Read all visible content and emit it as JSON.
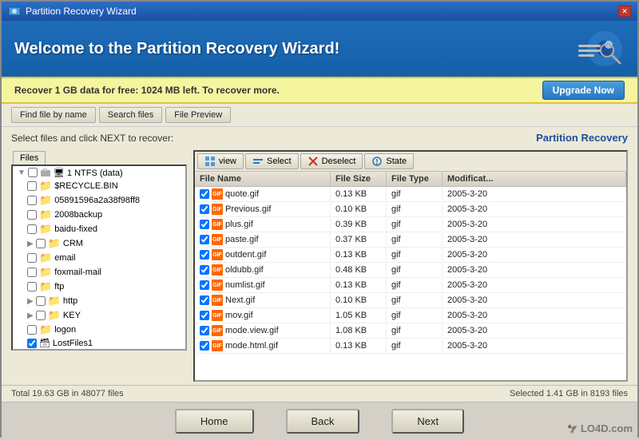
{
  "titlebar": {
    "title": "Partition Recovery Wizard",
    "close": "✕"
  },
  "header": {
    "title": "Welcome to the Partition Recovery Wizard!"
  },
  "promo": {
    "text": "Recover 1 GB data for free: 1024 MB left. To recover more.",
    "upgrade_label": "Upgrade Now"
  },
  "toolbar": {
    "find_label": "Find file by name",
    "search_label": "Search files",
    "preview_label": "File Preview"
  },
  "content": {
    "select_instruction": "Select files and click NEXT to recover:",
    "partition_label": "Partition Recovery",
    "files_tab": "Files"
  },
  "file_tree": {
    "root": "1 NTFS (data)",
    "items": [
      {
        "name": "$RECYCLE.BIN",
        "indent": 2,
        "checked": false
      },
      {
        "name": "05891596a2a38f98ff8",
        "indent": 2,
        "checked": false
      },
      {
        "name": "2008backup",
        "indent": 2,
        "checked": false
      },
      {
        "name": "baidu-fixed",
        "indent": 2,
        "checked": false
      },
      {
        "name": "CRM",
        "indent": 2,
        "checked": false
      },
      {
        "name": "email",
        "indent": 2,
        "checked": false
      },
      {
        "name": "foxmail-mail",
        "indent": 2,
        "checked": false
      },
      {
        "name": "ftp",
        "indent": 2,
        "checked": false
      },
      {
        "name": "http",
        "indent": 2,
        "checked": false
      },
      {
        "name": "KEY",
        "indent": 2,
        "checked": false
      },
      {
        "name": "logon",
        "indent": 2,
        "checked": false
      },
      {
        "name": "LostFiles1",
        "indent": 2,
        "checked": true
      }
    ]
  },
  "file_toolbar": {
    "view_label": "view",
    "select_label": "Select",
    "deselect_label": "Deselect",
    "state_label": "State"
  },
  "file_table": {
    "headers": [
      "File Name",
      "File Size",
      "File Type",
      "Modificat..."
    ],
    "rows": [
      {
        "name": "quote.gif",
        "size": "0.13 KB",
        "type": "gif",
        "modified": "2005-3-20",
        "checked": true
      },
      {
        "name": "Previous.gif",
        "size": "0.10 KB",
        "type": "gif",
        "modified": "2005-3-20",
        "checked": true
      },
      {
        "name": "plus.gif",
        "size": "0.39 KB",
        "type": "gif",
        "modified": "2005-3-20",
        "checked": true
      },
      {
        "name": "paste.gif",
        "size": "0.37 KB",
        "type": "gif",
        "modified": "2005-3-20",
        "checked": true
      },
      {
        "name": "outdent.gif",
        "size": "0.13 KB",
        "type": "gif",
        "modified": "2005-3-20",
        "checked": true
      },
      {
        "name": "oldubb.gif",
        "size": "0.48 KB",
        "type": "gif",
        "modified": "2005-3-20",
        "checked": true
      },
      {
        "name": "numlist.gif",
        "size": "0.13 KB",
        "type": "gif",
        "modified": "2005-3-20",
        "checked": true
      },
      {
        "name": "Next.gif",
        "size": "0.10 KB",
        "type": "gif",
        "modified": "2005-3-20",
        "checked": true
      },
      {
        "name": "mov.gif",
        "size": "1.05 KB",
        "type": "gif",
        "modified": "2005-3-20",
        "checked": true
      },
      {
        "name": "mode.view.gif",
        "size": "1.08 KB",
        "type": "gif",
        "modified": "2005-3-20",
        "checked": true
      },
      {
        "name": "mode.html.gif",
        "size": "0.13 KB",
        "type": "gif",
        "modified": "2005-3-20",
        "checked": true
      }
    ]
  },
  "status": {
    "left": "Total 19.63 GB in 48077 files",
    "right": "Selected 1.41 GB in 8193 files"
  },
  "buttons": {
    "home": "Home",
    "back": "Back",
    "next": "Next"
  },
  "watermark": "LO4D.com"
}
